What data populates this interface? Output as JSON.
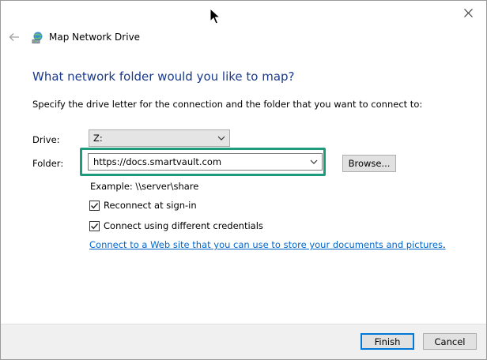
{
  "window": {
    "title": "Map Network Drive"
  },
  "heading": "What network folder would you like to map?",
  "instruction": "Specify the drive letter for the connection and the folder that you want to connect to:",
  "drive": {
    "label": "Drive:",
    "value": "Z:"
  },
  "folder": {
    "label": "Folder:",
    "value": "https://docs.smartvault.com",
    "browse_label": "Browse..."
  },
  "example": "Example: \\\\server\\share",
  "options": [
    {
      "label": "Reconnect at sign-in",
      "checked": true
    },
    {
      "label": "Connect using different credentials",
      "checked": true
    }
  ],
  "link": "Connect to a Web site that you can use to store your documents and pictures",
  "link_suffix": ".",
  "footer": {
    "finish_label": "Finish",
    "cancel_label": "Cancel"
  },
  "colors": {
    "heading": "#1a3a8a",
    "link": "#0066cc",
    "highlight": "#1e9a7c",
    "accent": "#0078d7"
  },
  "icons": {
    "close": "close-icon",
    "back": "back-arrow-icon",
    "app": "network-drive-icon",
    "dropdown": "chevron-down-icon",
    "check": "checkmark-icon"
  }
}
